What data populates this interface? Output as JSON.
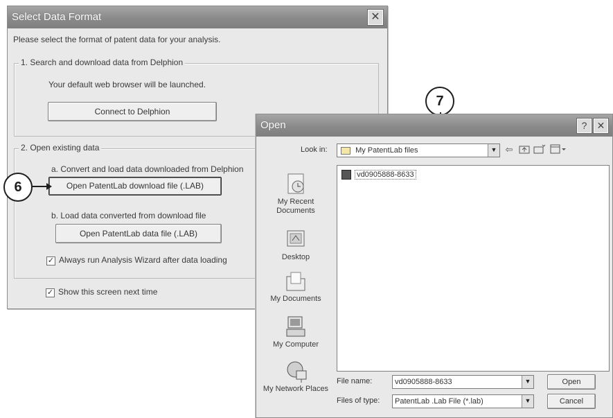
{
  "dialog1": {
    "title": "Select Data Format",
    "close": "✕",
    "intro": "Please select the format of patent data for your analysis.",
    "group1": {
      "label": "1. Search and download data from Delphion",
      "note": "Your default web browser will be launched.",
      "button": "Connect to Delphion"
    },
    "group2": {
      "label": "2. Open existing data",
      "option_a": "a. Convert and load data downloaded from Delphion",
      "button_a": "Open PatentLab download file (.LAB)",
      "option_b": "b. Load data converted from download file",
      "button_b": "Open PatentLab data file (.LAB)",
      "always_run_checked": true,
      "always_run": "Always run Analysis Wizard after data loading"
    },
    "show_next_checked": true,
    "show_next": "Show this screen next time"
  },
  "callouts": {
    "c6": "6",
    "c7": "7"
  },
  "open_dialog": {
    "title": "Open",
    "help": "?",
    "close": "✕",
    "look_in_label": "Look in:",
    "look_in_value": "My PatentLab files",
    "toolbar_icons": [
      "back-icon",
      "up-folder-icon",
      "new-folder-icon",
      "views-icon"
    ],
    "places": [
      {
        "label": "My Recent Documents",
        "icon": "recent-documents-icon"
      },
      {
        "label": "Desktop",
        "icon": "desktop-icon"
      },
      {
        "label": "My Documents",
        "icon": "my-documents-icon"
      },
      {
        "label": "My Computer",
        "icon": "my-computer-icon"
      },
      {
        "label": "My Network Places",
        "icon": "network-places-icon"
      }
    ],
    "files": [
      {
        "name": "vd0905888-8633",
        "icon": "lab-file-icon"
      }
    ],
    "filename_label": "File name:",
    "filename_value": "vd0905888-8633",
    "filetype_label": "Files of type:",
    "filetype_value": "PatentLab .Lab File (*.lab)",
    "open_button": "Open",
    "cancel_button": "Cancel"
  }
}
